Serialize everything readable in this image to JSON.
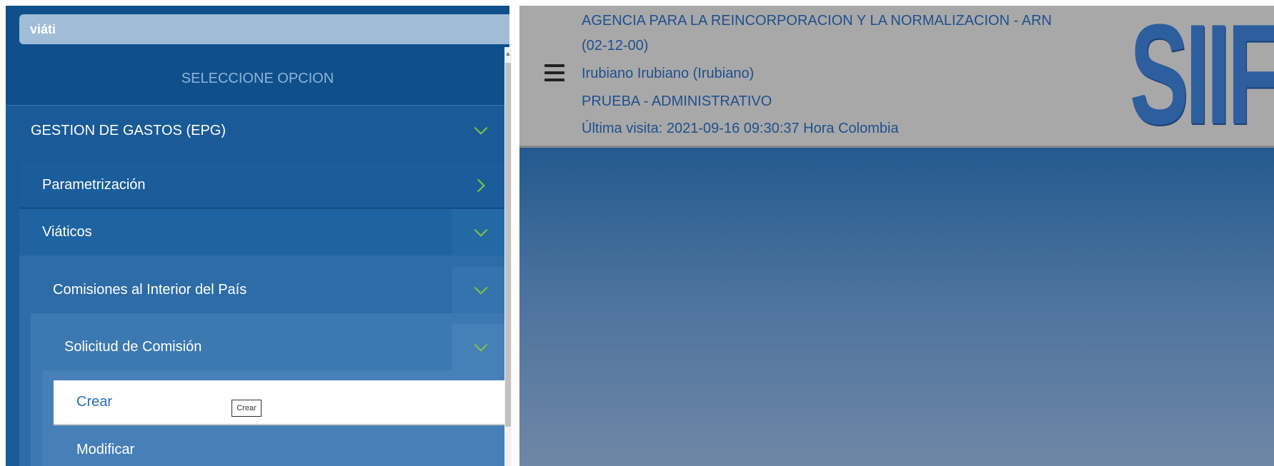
{
  "sidebar": {
    "search_value": "viáti",
    "section_title": "SELECCIONE OPCION",
    "items": [
      {
        "label": "GESTION DE GASTOS (EPG)"
      },
      {
        "label": "Parametrización"
      },
      {
        "label": "Viáticos"
      },
      {
        "label": "Comisiones al Interior del País"
      },
      {
        "label": "Solicitud de Comisión"
      },
      {
        "label": "Crear"
      },
      {
        "label": "Modificar"
      }
    ],
    "tooltip": "Crear"
  },
  "header": {
    "agency_line1": "AGENCIA PARA LA REINCORPORACION Y LA NORMALIZACION - ARN",
    "agency_line2": "(02-12-00)",
    "user": "Irubiano Irubiano (Irubiano)",
    "environment": "PRUEBA - ADMINISTRATIVO",
    "last_visit": "Última visita: 2021-09-16 09:30:37 Hora Colombia",
    "logo_text": "SIIF"
  },
  "colors": {
    "sidebar_bg": "#1a5a98",
    "header_bg": "#a8a8a8",
    "accent_chevron": "#7dc241",
    "selected_text": "#2a6db5"
  }
}
